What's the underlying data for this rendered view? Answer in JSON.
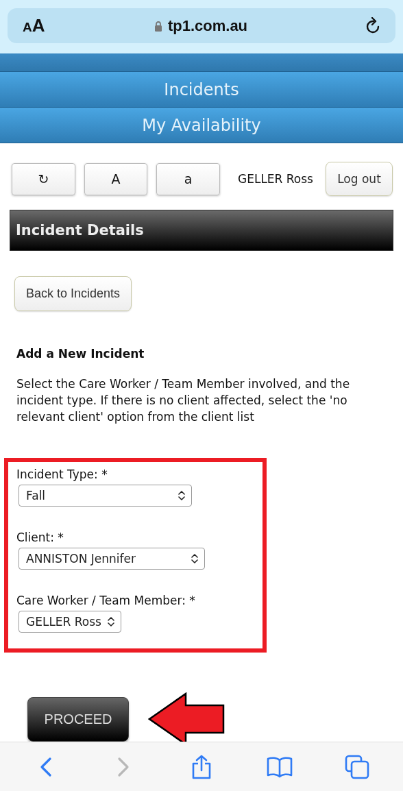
{
  "browser_bar": {
    "text_size_label": "AA",
    "url": "tp1.com.au"
  },
  "nav": [
    {
      "label": "Incidents"
    },
    {
      "label": "My Availability"
    }
  ],
  "tools": [
    "↻",
    "A",
    "a"
  ],
  "user": "GELLER Ross",
  "logout": "Log out",
  "header": "Incident Details",
  "back_button": "Back to Incidents",
  "form_title": "Add a New Incident",
  "instructions": "Select the Care Worker / Team Member involved, and the incident type. If there is no client affected, select the 'no relevant client' option from the client list",
  "fields": [
    {
      "label": "Incident Type: *",
      "value": "Fall"
    },
    {
      "label": "Client: *",
      "value": "ANNISTON Jennifer"
    },
    {
      "label": "Care Worker / Team Member: *",
      "value": "GELLER Ross"
    }
  ],
  "proceed": "PROCEED",
  "toolbar": [
    {
      "kind": "back",
      "disabled": false
    },
    {
      "kind": "forward",
      "disabled": true
    },
    {
      "kind": "share",
      "disabled": false
    },
    {
      "kind": "bookmarks",
      "disabled": false
    },
    {
      "kind": "tabs",
      "disabled": false
    }
  ]
}
